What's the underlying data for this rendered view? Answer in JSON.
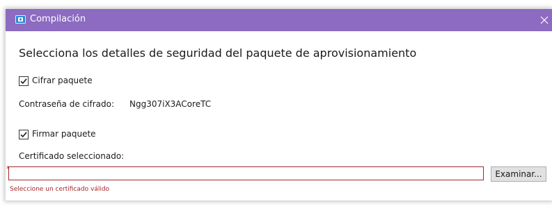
{
  "window": {
    "title": "Compilación",
    "app_icon": "package-icon",
    "close_icon": "close-icon"
  },
  "heading": "Selecciona los detalles de seguridad del paquete de aprovisionamiento",
  "encrypt": {
    "checked": true,
    "label": "Cifrar paquete",
    "password_label": "Contraseña de cifrado:",
    "password_value": "Ngg307iX3ACoreTC"
  },
  "sign": {
    "checked": true,
    "label": "Firmar paquete",
    "certificate_label": "Certificado seleccionado:",
    "required_marker": "*",
    "certificate_value": "",
    "browse_label": "Examinar...",
    "error": "Seleccione un certificado válido"
  },
  "colors": {
    "titlebar": "#8c6bc1",
    "error": "#a4262c"
  }
}
